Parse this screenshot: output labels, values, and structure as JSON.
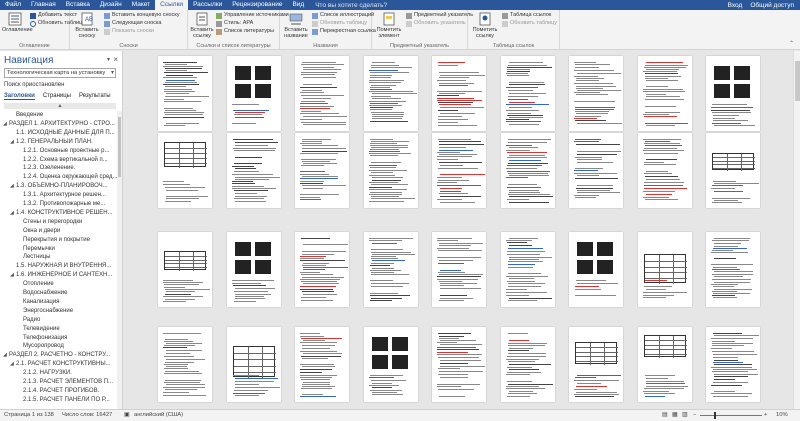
{
  "ribbon_tabs": [
    "Файл",
    "Главная",
    "Вставка",
    "Дизайн",
    "Макет",
    "Ссылки",
    "Рассылки",
    "Рецензирование",
    "Вид"
  ],
  "active_tab": "Ссылки",
  "tell_me": "Что вы хотите сделать?",
  "user": {
    "login": "Вход",
    "share": "Общий доступ"
  },
  "ribbon": {
    "toc": {
      "big": "Оглавление",
      "add_text": "Добавить текст",
      "update": "Обновить таблицу",
      "label": "Оглавление"
    },
    "footnotes": {
      "big": "Вставить сноску",
      "endnote": "Вставить концевую сноску",
      "next": "Следующая сноска",
      "show": "Показать сноски",
      "label": "Сноски"
    },
    "citations": {
      "big": "Вставить ссылку",
      "manage": "Управление источниками",
      "style": "Стиль: APA",
      "bib": "Список литературы",
      "label": "Ссылки и список литературы"
    },
    "captions": {
      "big": "Вставить название",
      "illus": "Список иллюстраций",
      "update": "Обновить таблицу",
      "cross": "Перекрестная ссылка",
      "label": "Названия"
    },
    "index": {
      "big": "Пометить элемент",
      "insert": "Предметный указатель",
      "update": "Обновить указатель",
      "label": "Предметный указатель"
    },
    "toa": {
      "big": "Пометить ссылку",
      "insert": "Таблица ссылок",
      "update": "Обновить таблицу",
      "label": "Таблица ссылок"
    }
  },
  "nav": {
    "title": "Навигация",
    "search_value": "Технологическая карта на установку",
    "sub": "Поиск приостановлен",
    "tabs": [
      "Заголовки",
      "Страницы",
      "Результаты"
    ],
    "active_tab": "Заголовки",
    "items": [
      {
        "text": "Введение",
        "indent": 1,
        "tri": "",
        "sel": false
      },
      {
        "text": "РАЗДЕЛ 1. АРХИТЕКТУРНО - СТРО...",
        "indent": 0,
        "tri": "◢",
        "sel": false
      },
      {
        "text": "1.1. ИСХОДНЫЕ ДАННЫЕ ДЛЯ П...",
        "indent": 1,
        "tri": "",
        "sel": false
      },
      {
        "text": "1.2. ГЕНЕРАЛЬНЫЙ ПЛАН.",
        "indent": 1,
        "tri": "◢",
        "sel": false
      },
      {
        "text": "1.2.1. Основные проектные р...",
        "indent": 2,
        "tri": "",
        "sel": false
      },
      {
        "text": "1.2.2. Схема вертикальной п...",
        "indent": 2,
        "tri": "",
        "sel": false
      },
      {
        "text": "1.2.3. Озеленение.",
        "indent": 2,
        "tri": "",
        "sel": false
      },
      {
        "text": "1.2.4. Оценка окружающей сред...",
        "indent": 2,
        "tri": "",
        "sel": false
      },
      {
        "text": "1.3. ОБЪЕМНО-ПЛАНИРОВОЧ...",
        "indent": 1,
        "tri": "◢",
        "sel": false
      },
      {
        "text": "1.3.1. Архитектурное решен...",
        "indent": 2,
        "tri": "",
        "sel": false
      },
      {
        "text": "1.3.2. Противопожарные ме...",
        "indent": 2,
        "tri": "",
        "sel": false
      },
      {
        "text": "1.4. КОНСТРУКТИВНОЕ РЕШЕН...",
        "indent": 1,
        "tri": "◢",
        "sel": false
      },
      {
        "text": "Стены и перегородки",
        "indent": 2,
        "tri": "",
        "sel": false
      },
      {
        "text": "Окна и двери",
        "indent": 2,
        "tri": "",
        "sel": false
      },
      {
        "text": "Перекрытия и покрытие",
        "indent": 2,
        "tri": "",
        "sel": false
      },
      {
        "text": "Перемычки",
        "indent": 2,
        "tri": "",
        "sel": false
      },
      {
        "text": "Лестницы",
        "indent": 2,
        "tri": "",
        "sel": false
      },
      {
        "text": "1.5. НАРУЖНАЯ И ВНУТРЕННЯ...",
        "indent": 1,
        "tri": "",
        "sel": false
      },
      {
        "text": "1.6. ИНЖЕНЕРНОЕ И САНТЕХН...",
        "indent": 1,
        "tri": "◢",
        "sel": false
      },
      {
        "text": "Отопление",
        "indent": 2,
        "tri": "",
        "sel": false
      },
      {
        "text": "Водоснабжение",
        "indent": 2,
        "tri": "",
        "sel": false
      },
      {
        "text": "Канализация",
        "indent": 2,
        "tri": "",
        "sel": false
      },
      {
        "text": "Энергоснабжение",
        "indent": 2,
        "tri": "",
        "sel": false
      },
      {
        "text": "Радио",
        "indent": 2,
        "tri": "",
        "sel": false
      },
      {
        "text": "Телевидение",
        "indent": 2,
        "tri": "",
        "sel": false
      },
      {
        "text": "Телефонизация",
        "indent": 2,
        "tri": "",
        "sel": false
      },
      {
        "text": "Мусоропровод",
        "indent": 2,
        "tri": "",
        "sel": false
      },
      {
        "text": "РАЗДЕЛ 2. РАСЧЕТНО - КОНСТРУ...",
        "indent": 0,
        "tri": "◢",
        "sel": false
      },
      {
        "text": "2.1. РАСЧЕТ КОНСТРУКТИВНЫ...",
        "indent": 1,
        "tri": "◢",
        "sel": false
      },
      {
        "text": "2.1.2. НАГРУЗКИ.",
        "indent": 2,
        "tri": "",
        "sel": false
      },
      {
        "text": "2.1.3. РАСЧЕТ ЭЛЕМЕНТОВ П...",
        "indent": 2,
        "tri": "",
        "sel": false
      },
      {
        "text": "2.1.4. РАСЧЕТ ПРОГИБОВ.",
        "indent": 2,
        "tri": "",
        "sel": false
      },
      {
        "text": "2.1.5. РАСЧЕТ ПАНЕЛИ ПО Р...",
        "indent": 2,
        "tri": "",
        "sel": false
      }
    ]
  },
  "status": {
    "page": "Страница 1 из 138",
    "words": "Число слов: 16427",
    "lang": "английский (США)",
    "zoom": "10%"
  },
  "colors": {
    "accent": "#2b579a",
    "ribbon": "#f3f3f3",
    "doc_bg": "#e6e6e6"
  }
}
